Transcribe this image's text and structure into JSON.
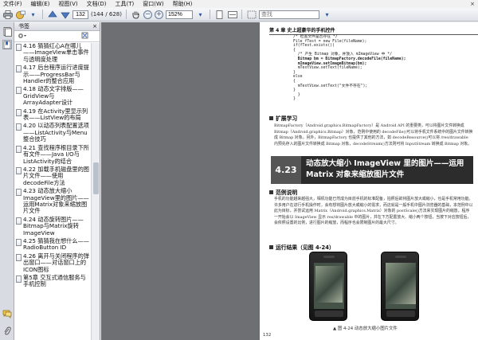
{
  "menubar": {
    "items": [
      "文件(F)",
      "编辑(E)",
      "视图(V)",
      "文档(D)",
      "工具(T)",
      "窗口(W)",
      "帮助(H)"
    ],
    "close_glyph": "×"
  },
  "toolbar": {
    "page_current": "132",
    "page_total": "(144 / 628)",
    "zoom": "152%",
    "search_placeholder": "查找",
    "icons": [
      "printer-icon",
      "email-icon",
      "previous-page-icon",
      "next-page-icon",
      "zoom-out-icon",
      "zoom-in-icon",
      "fit-page-icon",
      "fit-width-icon",
      "find-dropdown-icon"
    ]
  },
  "bookmarks": {
    "title": "书签",
    "close_glyph": "×",
    "items": [
      {
        "label": "4.16 猜猜红心A在哪儿——ImageView单击事件与透明度处理"
      },
      {
        "label": "4.17 后台程序运行进度提示——ProgressBar与Handler的整合应用"
      },
      {
        "label": "4.18 动态文字排版——GridView与ArrayAdapter设计"
      },
      {
        "label": "4.19 在Activity里显示列表——ListView的布局"
      },
      {
        "label": "4.20 以动态列表配置选项——ListActivity与Menu整合技巧"
      },
      {
        "label": "4.21 查找程序根目录下所有文件——Java I/O与ListActivity的结合"
      },
      {
        "label": "4.22 加载手机磁盘里的图片文件——使用decodeFile方法"
      },
      {
        "label": "4.23 动态放大缩小ImageView里的图片——运用Matrix对象来缩放图片文件"
      },
      {
        "label": "4.24 动态旋转图片——Bitmap与Matrix旋转ImageView"
      },
      {
        "label": "4.25 猜猜我在想什么——RadioButton ID"
      },
      {
        "label": "4.26 离开与关闭程序的弹出窗口——对话窗口上的ICON图标"
      },
      {
        "label": "第5章 交互式通信服务与手机控制"
      }
    ]
  },
  "page": {
    "header": "第 4 章   史上超豪华的手机控件",
    "code_lines": [
      "/* 检查文件是否存在 */",
      "File fTest = new File(fileName);",
      "if(fTest.exists())",
      "{",
      "  /* 产生 Bitmap 对象，并放入 mImageView 中 */",
      "  Bitmap bm = BitmapFactory.decodeFile(fileName);",
      "  mImageView.setImageBitmap(bm);",
      "  mTextView.setText(fileName);",
      "}",
      "else",
      "{",
      "  mTextView.setText(\"文件不存在\");",
      "}",
      "  }",
      "}"
    ],
    "section1": "扩展学习",
    "section1_text": "BitmapFactory（Android.graphics.BitmapFactory）是 Android API 的重要类，可以将图片文件转换成 Bitmap（Android.graphics.Bitmap）对象，范例中使用的 decodeFile()可以将手机文件系统中的图片文件转换成 Bitmap 对象。另外，BitmapFactory 也提供了其他的方法，如 decodeResource()可以将 /res/drawable 内预先存入的图片文件转换成 Bitmap 对象，decodeStream()方法则可将 InputStream 转换成 Bitmap 对象。",
    "chapter_num": "4.23",
    "chapter_title": "动态放大缩小 ImageView 里的图片——运用 Matrix 对象来缩放图片文件",
    "section2": "范例说明",
    "section2_text": "手机的功能越来越强大，相机功能已然成为目前手机的标准配备，拍照后欲将图片放大或缩小，也是手机常用功能。许多用户在进行手机操作时，会有想将图片放大或缩小的需求，而这就是一般手机中图片浏览器的基础，本范例中以此为目标，并尝试运用 Matrix（Android.graphics.Matrix）对象的 postScale()方法来实现图片的缩放，程序一开始会以 ImageView 显示 res/drawable 中的图片，并在下方配置放大、缩小两个按钮，当按下对应按钮后，会依照设置的比例，进行图片的缩放，而程序也会限制图片的最大尺寸。",
    "section3": "运行结果（见图 4-24）",
    "caption": "▲ 图 4-24   动态放大缩小图片文件",
    "page_number": "132"
  },
  "watermark": {
    "symbol": "雨",
    "text": "POO"
  }
}
